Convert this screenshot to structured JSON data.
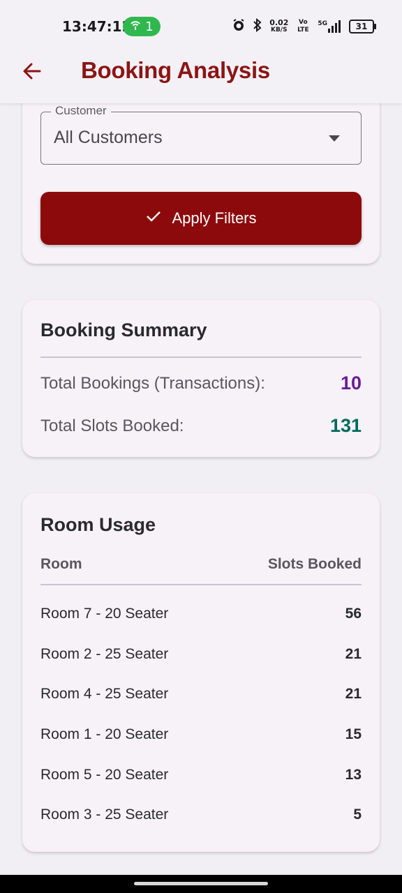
{
  "status_bar": {
    "time": "13:47:12",
    "hotspot_count": "1",
    "net_speed_top": "0.02",
    "net_speed_unit": "KB/S",
    "volte": "Vo LTE",
    "network": "5G",
    "battery": "31"
  },
  "app_bar": {
    "title": "Booking Analysis",
    "back_icon": "arrow-left-icon"
  },
  "filters": {
    "customer_label": "Customer",
    "customer_value": "All Customers",
    "apply_label": "Apply Filters"
  },
  "summary": {
    "title": "Booking Summary",
    "items": [
      {
        "label": "Total Bookings (Transactions):",
        "value": "10",
        "color": "#6a1b9a"
      },
      {
        "label": "Total Slots Booked:",
        "value": "131",
        "color": "#00695c"
      }
    ]
  },
  "room_usage": {
    "title": "Room Usage",
    "columns": [
      "Room",
      "Slots Booked"
    ],
    "rows": [
      {
        "room": "Room 7 - 20 Seater",
        "slots": "56"
      },
      {
        "room": "Room 2 - 25 Seater",
        "slots": "21"
      },
      {
        "room": "Room 4 - 25 Seater",
        "slots": "21"
      },
      {
        "room": "Room 1 - 20 Seater",
        "slots": "15"
      },
      {
        "room": "Room 5 - 20 Seater",
        "slots": "13"
      },
      {
        "room": "Room 3 - 25 Seater",
        "slots": "5"
      }
    ]
  },
  "colors": {
    "accent": "#8c0a0c",
    "title": "#8c1414"
  }
}
